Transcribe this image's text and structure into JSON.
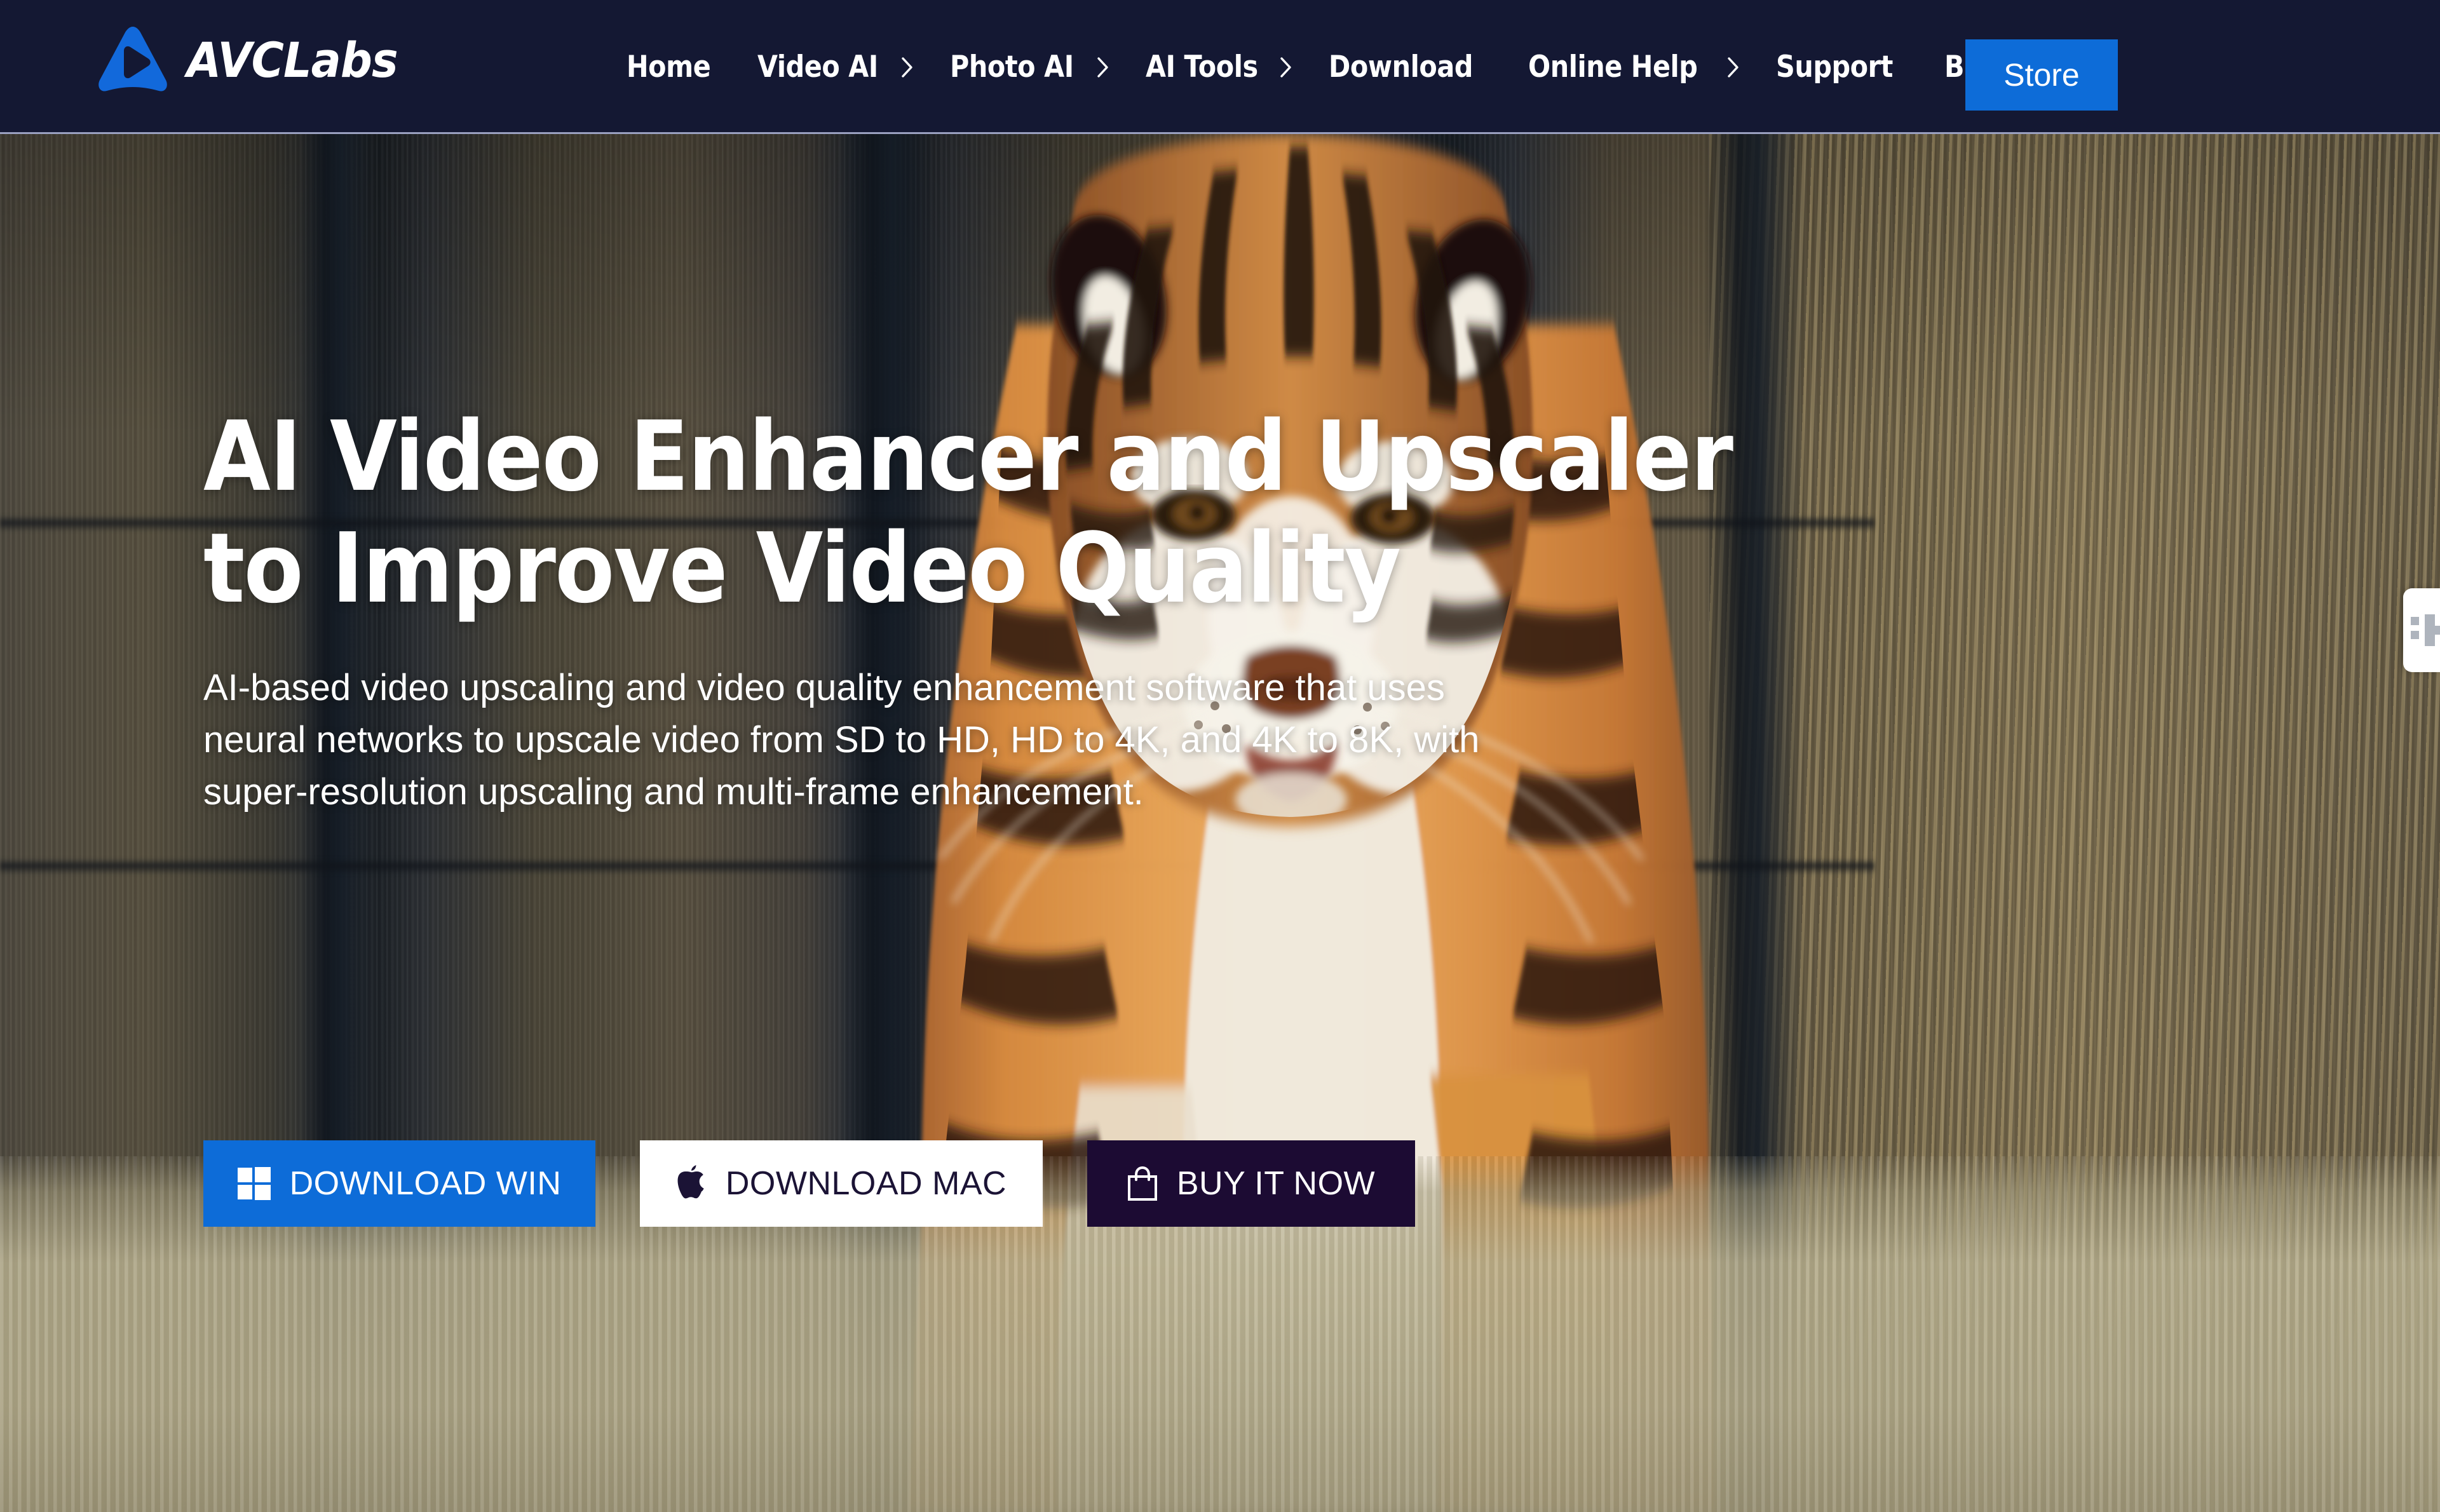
{
  "brand": {
    "name": "AVCLabs",
    "logo_icon": "avclabs-play-triangle-logo",
    "accent_blue": "#0d6cd8",
    "header_bg": "#141833",
    "dark_navy": "#1c0b33"
  },
  "nav": {
    "items": [
      {
        "label": "Home",
        "has_chevron": false
      },
      {
        "label": "Video AI",
        "has_chevron": true
      },
      {
        "label": "Photo AI",
        "has_chevron": true
      },
      {
        "label": "AI Tools",
        "has_chevron": true
      },
      {
        "label": "Download",
        "has_chevron": false
      },
      {
        "label": "Online Help",
        "has_chevron": true
      },
      {
        "label": "Support",
        "has_chevron": false
      },
      {
        "label": "Blog",
        "has_chevron": true
      }
    ],
    "store_label": "Store"
  },
  "hero": {
    "headline_line1": "AI Video Enhancer and Upscaler",
    "headline_line2": "to Improve Video Quality",
    "description": "AI-based video upscaling and video quality enhancement software that uses neural networks to upscale video from SD to HD, HD to 4K, and 4K to 8K, with super-resolution upscaling and multi-frame enhancement.",
    "background_subject": "tiger walking toward camera in front of a metal fence",
    "buttons": [
      {
        "label": "DOWNLOAD WIN",
        "icon": "windows-icon",
        "style": "blue"
      },
      {
        "label": "DOWNLOAD MAC",
        "icon": "apple-icon",
        "style": "white"
      },
      {
        "label": "BUY IT NOW",
        "icon": "shopping-bag-icon",
        "style": "dark"
      }
    ]
  },
  "side_widget": {
    "icon": "chat-widget-icon"
  }
}
